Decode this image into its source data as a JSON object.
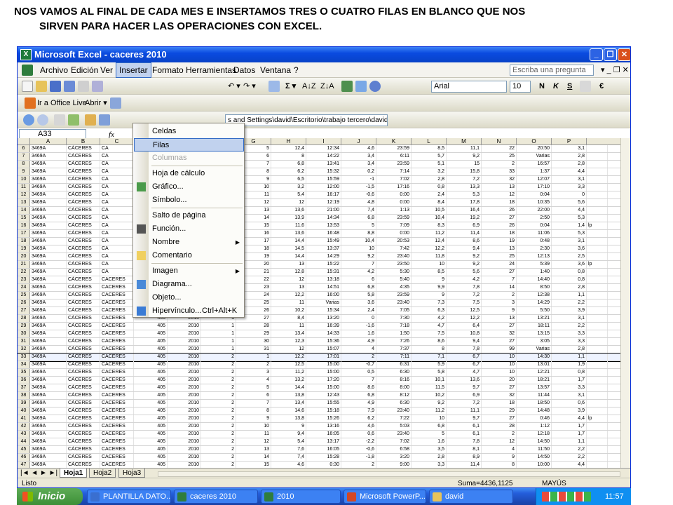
{
  "caption": {
    "line1": "NOS VAMOS AL FINAL DE CADA MES E INSERTAMOS TRES O CUATRO FILAS EN BLANCO QUE NOS",
    "line2": "SIRVEN PARA HACER LAS OPERACIONES CON EXCEL."
  },
  "window": {
    "title": "Microsoft Excel - caceres 2010",
    "app_icon": "X"
  },
  "menubar": {
    "items": [
      "Archivo",
      "Edición",
      "Ver",
      "Insertar",
      "Formato",
      "Herramientas",
      "Datos",
      "Ventana",
      "?"
    ],
    "active": "Insertar",
    "help_placeholder": "Escriba una pregunta"
  },
  "toolbar": {
    "font_name": "Arial",
    "font_size": "10",
    "bold": "N",
    "italic": "K",
    "underline": "S",
    "currency": "€"
  },
  "toolbar2": {
    "office_live": "Ir a Office Live",
    "open": "Abrir ▾",
    "path": "s and Settings\\david\\Escritorio\\trabajo tercero\\david\\"
  },
  "formula_bar": {
    "name_box": "A33",
    "fx": "fx"
  },
  "insert_menu": {
    "items": [
      {
        "label": "Celdas",
        "enabled": true,
        "icon": "none"
      },
      {
        "label": "Filas",
        "enabled": true,
        "highlighted": true,
        "icon": "none"
      },
      {
        "label": "Columnas",
        "enabled": false,
        "icon": "none"
      },
      {
        "label": "Hoja de cálculo",
        "enabled": true,
        "icon": "none"
      },
      {
        "label": "Gráfico...",
        "enabled": true,
        "icon": "chart-icon"
      },
      {
        "label": "Símbolo...",
        "enabled": true,
        "icon": "none"
      },
      {
        "label": "Salto de página",
        "enabled": true,
        "icon": "none"
      },
      {
        "label": "Función...",
        "enabled": true,
        "icon": "function-icon"
      },
      {
        "label": "Nombre",
        "enabled": true,
        "submenu": true,
        "icon": "none"
      },
      {
        "label": "Comentario",
        "enabled": true,
        "icon": "comment-icon"
      },
      {
        "label": "Imagen",
        "enabled": true,
        "submenu": true,
        "icon": "none"
      },
      {
        "label": "Diagrama...",
        "enabled": true,
        "icon": "diagram-icon"
      },
      {
        "label": "Objeto...",
        "enabled": true,
        "icon": "none"
      },
      {
        "label": "Hipervínculo...",
        "shortcut": "Ctrl+Alt+K",
        "enabled": true,
        "icon": "hyperlink-icon"
      }
    ]
  },
  "columns": [
    "A",
    "B",
    "C",
    "D",
    "E",
    "F",
    "G",
    "H",
    "I",
    "J",
    "K",
    "L",
    "M",
    "N",
    "O",
    "P"
  ],
  "rows": [
    [
      "6",
      "3469A",
      "CÁCERES",
      "CA",
      "",
      "",
      "1",
      "5",
      "12,4",
      "12:34",
      "4,6",
      "23:59",
      "8,5",
      "11,1",
      "22",
      "20:50",
      "3,1",
      ""
    ],
    [
      "7",
      "3469A",
      "CÁCERES",
      "CA",
      "",
      "",
      "1",
      "6",
      "8",
      "14:22",
      "3,4",
      "6:11",
      "5,7",
      "9,2",
      "25",
      "Varias",
      "2,8",
      ""
    ],
    [
      "8",
      "3469A",
      "CÁCERES",
      "CA",
      "",
      "",
      "1",
      "7",
      "6,8",
      "13:41",
      "3,4",
      "23:59",
      "5,1",
      "15",
      "2",
      "16:57",
      "2,8",
      ""
    ],
    [
      "9",
      "3469A",
      "CÁCERES",
      "CA",
      "",
      "",
      "1",
      "8",
      "6,2",
      "15:32",
      "0,2",
      "7:14",
      "3,2",
      "15,8",
      "33",
      "1:37",
      "4,4",
      ""
    ],
    [
      "10",
      "3469A",
      "CÁCERES",
      "CA",
      "",
      "",
      "1",
      "9",
      "6,5",
      "15:59",
      "-1",
      "7:02",
      "2,8",
      "7,2",
      "32",
      "12:07",
      "3,1",
      ""
    ],
    [
      "11",
      "3469A",
      "CÁCERES",
      "CA",
      "",
      "",
      "1",
      "10",
      "3,2",
      "12:00",
      "-1,5",
      "17:16",
      "0,8",
      "13,3",
      "13",
      "17:10",
      "3,3",
      ""
    ],
    [
      "12",
      "3469A",
      "CÁCERES",
      "CA",
      "",
      "",
      "1",
      "11",
      "5,4",
      "16:17",
      "-0,6",
      "0:00",
      "2,4",
      "5,3",
      "12",
      "0:04",
      "0",
      ""
    ],
    [
      "13",
      "3469A",
      "CÁCERES",
      "CA",
      "",
      "",
      "1",
      "12",
      "12",
      "12:19",
      "4,8",
      "0:00",
      "8,4",
      "17,8",
      "18",
      "10:35",
      "5,6",
      ""
    ],
    [
      "14",
      "3469A",
      "CÁCERES",
      "CA",
      "",
      "",
      "1",
      "13",
      "13,6",
      "21:00",
      "7,4",
      "1:13",
      "10,5",
      "16,4",
      "26",
      "22:00",
      "4,4",
      ""
    ],
    [
      "15",
      "3469A",
      "CÁCERES",
      "CA",
      "",
      "",
      "1",
      "14",
      "13,9",
      "14:34",
      "6,8",
      "23:59",
      "10,4",
      "19,2",
      "27",
      "2:50",
      "5,3",
      ""
    ],
    [
      "16",
      "3469A",
      "CÁCERES",
      "CA",
      "",
      "",
      "1",
      "15",
      "11,6",
      "13:53",
      "5",
      "7:09",
      "8,3",
      "6,9",
      "26",
      "0:04",
      "1,4",
      "lp"
    ],
    [
      "17",
      "3469A",
      "CÁCERES",
      "CA",
      "",
      "",
      "1",
      "16",
      "13,6",
      "16:48",
      "8,8",
      "0:00",
      "11,2",
      "11,4",
      "18",
      "11:06",
      "5,3",
      ""
    ],
    [
      "18",
      "3469A",
      "CÁCERES",
      "CA",
      "",
      "",
      "1",
      "17",
      "14,4",
      "15:49",
      "10,4",
      "20:53",
      "12,4",
      "8,6",
      "19",
      "0:48",
      "3,1",
      ""
    ],
    [
      "19",
      "3469A",
      "CÁCERES",
      "CA",
      "",
      "",
      "1",
      "18",
      "14,5",
      "13:37",
      "10",
      "7:42",
      "12,2",
      "9,4",
      "13",
      "2:30",
      "3,6",
      ""
    ],
    [
      "20",
      "3469A",
      "CÁCERES",
      "CA",
      "",
      "",
      "1",
      "19",
      "14,4",
      "14:29",
      "9,2",
      "23:40",
      "11,8",
      "9,2",
      "25",
      "12:13",
      "2,5",
      ""
    ],
    [
      "21",
      "3469A",
      "CÁCERES",
      "CA",
      "",
      "",
      "1",
      "20",
      "13",
      "15:22",
      "7",
      "23:50",
      "10",
      "9,2",
      "24",
      "5:39",
      "3,6",
      "lp"
    ],
    [
      "22",
      "3469A",
      "CÁCERES",
      "CA",
      "",
      "",
      "1",
      "21",
      "12,8",
      "15:31",
      "4,2",
      "5:30",
      "8,5",
      "5,6",
      "27",
      "1:40",
      "0,8",
      ""
    ],
    [
      "23",
      "3469A",
      "CÁCERES",
      "CACERES",
      "405",
      "2010",
      "1",
      "22",
      "12",
      "13:18",
      "6",
      "5:40",
      "9",
      "4,2",
      "7",
      "14:40",
      "0,8",
      ""
    ],
    [
      "24",
      "3469A",
      "CÁCERES",
      "CACERES",
      "405",
      "2010",
      "1",
      "23",
      "13",
      "14:51",
      "6,8",
      "4:35",
      "9,9",
      "7,8",
      "14",
      "8:50",
      "2,8",
      ""
    ],
    [
      "25",
      "3469A",
      "CÁCERES",
      "CACERES",
      "405",
      "2010",
      "1",
      "24",
      "12,2",
      "16:00",
      "5,8",
      "23:59",
      "9",
      "7,2",
      "2",
      "12:38",
      "1,1",
      ""
    ],
    [
      "26",
      "3469A",
      "CÁCERES",
      "CACERES",
      "405",
      "2010",
      "1",
      "25",
      "11",
      "Varias",
      "3,6",
      "23:40",
      "7,3",
      "7,5",
      "3",
      "14:29",
      "2,2",
      ""
    ],
    [
      "27",
      "3469A",
      "CÁCERES",
      "CACERES",
      "405",
      "2010",
      "1",
      "26",
      "10,2",
      "15:34",
      "2,4",
      "7:05",
      "6,3",
      "12,5",
      "9",
      "5:50",
      "3,9",
      ""
    ],
    [
      "28",
      "3469A",
      "CÁCERES",
      "CACERES",
      "405",
      "2010",
      "1",
      "27",
      "8,4",
      "13:20",
      "0",
      "7:30",
      "4,2",
      "12,2",
      "13",
      "13:21",
      "3,1",
      ""
    ],
    [
      "29",
      "3469A",
      "CÁCERES",
      "CACERES",
      "405",
      "2010",
      "1",
      "28",
      "11",
      "16:39",
      "-1,6",
      "7:18",
      "4,7",
      "6,4",
      "27",
      "18:11",
      "2,2",
      ""
    ],
    [
      "30",
      "3469A",
      "CÁCERES",
      "CACERES",
      "405",
      "2010",
      "1",
      "29",
      "13,4",
      "14:33",
      "1,6",
      "1:50",
      "7,5",
      "10,8",
      "32",
      "13:15",
      "3,3",
      ""
    ],
    [
      "31",
      "3469A",
      "CÁCERES",
      "CACERES",
      "405",
      "2010",
      "1",
      "30",
      "12,3",
      "15:36",
      "4,9",
      "7:26",
      "8,6",
      "9,4",
      "27",
      "3:05",
      "3,3",
      ""
    ],
    [
      "32",
      "3469A",
      "CÁCERES",
      "CACERES",
      "405",
      "2010",
      "1",
      "31",
      "12",
      "15:07",
      "4",
      "7:37",
      "8",
      "7,8",
      "99",
      "Varias",
      "2,8",
      ""
    ],
    [
      "33",
      "3469A",
      "CÁCERES",
      "CACERES",
      "405",
      "2010",
      "2",
      "1",
      "12,2",
      "17:01",
      "2",
      "7:11",
      "7,1",
      "6,7",
      "10",
      "14:30",
      "1,1",
      ""
    ],
    [
      "34",
      "3469A",
      "CÁCERES",
      "CACERES",
      "405",
      "2010",
      "2",
      "2",
      "12,5",
      "15:00",
      "-0,7",
      "6:31",
      "5,9",
      "6,7",
      "10",
      "13:01",
      "1,9",
      ""
    ],
    [
      "35",
      "3469A",
      "CÁCERES",
      "CACERES",
      "405",
      "2010",
      "2",
      "3",
      "11,2",
      "15:00",
      "0,5",
      "6:30",
      "5,8",
      "4,7",
      "10",
      "12:21",
      "0,8",
      ""
    ],
    [
      "36",
      "3469A",
      "CÁCERES",
      "CACERES",
      "405",
      "2010",
      "2",
      "4",
      "13,2",
      "17:20",
      "7",
      "8:16",
      "10,1",
      "13,6",
      "20",
      "18:21",
      "1,7",
      ""
    ],
    [
      "37",
      "3469A",
      "CÁCERES",
      "CACERES",
      "405",
      "2010",
      "2",
      "5",
      "14,4",
      "15:00",
      "8,6",
      "8:00",
      "11,5",
      "9,7",
      "27",
      "13:57",
      "3,3",
      ""
    ],
    [
      "38",
      "3469A",
      "CÁCERES",
      "CACERES",
      "405",
      "2010",
      "2",
      "6",
      "13,8",
      "12:43",
      "6,8",
      "8:12",
      "10,2",
      "6,9",
      "32",
      "11:44",
      "3,1",
      ""
    ],
    [
      "39",
      "3469A",
      "CÁCERES",
      "CACERES",
      "405",
      "2010",
      "2",
      "7",
      "13,4",
      "15:55",
      "4,9",
      "6:30",
      "9,2",
      "7,2",
      "18",
      "18:50",
      "0,6",
      ""
    ],
    [
      "40",
      "3469A",
      "CÁCERES",
      "CACERES",
      "405",
      "2010",
      "2",
      "8",
      "14,6",
      "15:18",
      "7,9",
      "23:40",
      "11,2",
      "11,1",
      "29",
      "14:48",
      "3,9",
      ""
    ],
    [
      "41",
      "3469A",
      "CÁCERES",
      "CACERES",
      "405",
      "2010",
      "2",
      "9",
      "13,8",
      "15:26",
      "6,2",
      "7:22",
      "10",
      "9,7",
      "27",
      "0:46",
      "4,4",
      "lp"
    ],
    [
      "42",
      "3469A",
      "CÁCERES",
      "CACERES",
      "405",
      "2010",
      "2",
      "10",
      "9",
      "13:16",
      "4,6",
      "5:03",
      "6,8",
      "6,1",
      "28",
      "1:12",
      "1,7",
      ""
    ],
    [
      "43",
      "3469A",
      "CÁCERES",
      "CACERES",
      "405",
      "2010",
      "2",
      "11",
      "9,4",
      "16:05",
      "0,6",
      "23:40",
      "5",
      "6,1",
      "2",
      "12:18",
      "1,7",
      ""
    ],
    [
      "44",
      "3469A",
      "CÁCERES",
      "CACERES",
      "405",
      "2010",
      "2",
      "12",
      "5,4",
      "13:17",
      "-2,2",
      "7:02",
      "1,6",
      "7,8",
      "12",
      "14:50",
      "1,1",
      ""
    ],
    [
      "45",
      "3469A",
      "CÁCERES",
      "CACERES",
      "405",
      "2010",
      "2",
      "13",
      "7,6",
      "16:05",
      "-0,6",
      "6:58",
      "3,5",
      "8,1",
      "4",
      "11:50",
      "2,2",
      ""
    ],
    [
      "46",
      "3469A",
      "CÁCERES",
      "CACERES",
      "405",
      "2010",
      "2",
      "14",
      "7,4",
      "15:28",
      "-1,8",
      "3:20",
      "2,8",
      "8,9",
      "9",
      "14:50",
      "2,2",
      ""
    ],
    [
      "47",
      "3469A",
      "CÁCERES",
      "CACERES",
      "405",
      "2010",
      "2",
      "15",
      "4,6",
      "0:30",
      "2",
      "9:00",
      "3,3",
      "11,4",
      "8",
      "10:00",
      "4,4",
      ""
    ]
  ],
  "selected_row": "33",
  "sheet_tabs": [
    "Hoja1",
    "Hoja2",
    "Hoja3"
  ],
  "active_sheet": "Hoja1",
  "status": {
    "left": "Listo",
    "sum": "Suma=4436,1125",
    "caps": "MAYÚS"
  },
  "taskbar": {
    "start": "Inicio",
    "tasks": [
      "PLANTILLA DATO...",
      "caceres 2010",
      "2010",
      "Microsoft PowerP...",
      "david"
    ],
    "clock": "11:57"
  },
  "colors": {
    "titlebar": "#0a4be0",
    "highlight": "#c1d2ee",
    "taskbar": "#245edb",
    "start": "#3c8f37"
  }
}
